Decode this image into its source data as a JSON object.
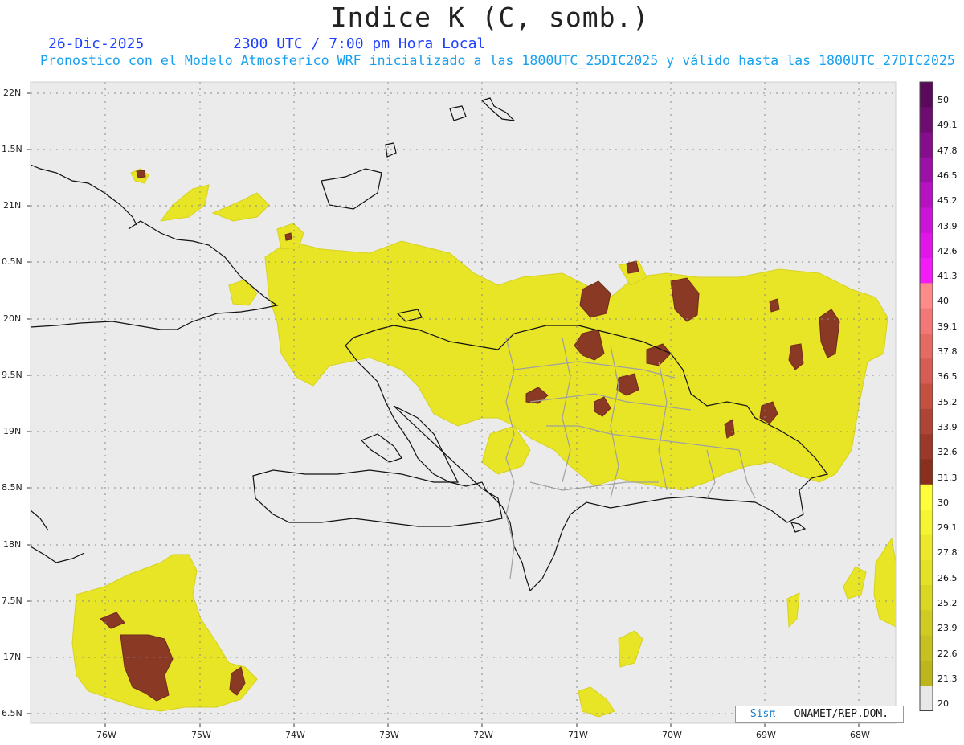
{
  "header": {
    "title": "Indice K (C, somb.)",
    "date": "26-Dic-2025",
    "time": "2300 UTC / 7:00 pm Hora Local",
    "description": "Pronostico con el Modelo Atmosferico WRF inicializado a las 1800UTC_25DIC2025 y válido hasta las  1800UTC_27DIC2025"
  },
  "axes": {
    "lat_labels": [
      "22N",
      "1.5N",
      "21N",
      "0.5N",
      "20N",
      "9.5N",
      "19N",
      "8.5N",
      "18N",
      "7.5N",
      "17N",
      "6.5N"
    ],
    "lon_labels": [
      "76W",
      "75W",
      "74W",
      "73W",
      "72W",
      "71W",
      "70W",
      "69W",
      "68W"
    ]
  },
  "colorbar": {
    "levels": [
      "50",
      "49.1",
      "47.8",
      "46.5",
      "45.2",
      "43.9",
      "42.6",
      "41.3",
      "40",
      "39.1",
      "37.8",
      "36.5",
      "35.2",
      "33.9",
      "32.6",
      "31.3",
      "30",
      "29.1",
      "27.8",
      "26.5",
      "25.2",
      "23.9",
      "22.6",
      "21.3",
      "20"
    ],
    "colors": [
      "#5a0a5a",
      "#6e0c72",
      "#860e8c",
      "#9c10a8",
      "#b612c2",
      "#cc14d6",
      "#e016e8",
      "#f21cf6",
      "#ff8a8a",
      "#f27878",
      "#e46a62",
      "#d65c54",
      "#c4503f",
      "#b04434",
      "#9c382a",
      "#8a2e1e",
      "#fdfd3a",
      "#f5f532",
      "#ece92c",
      "#e3e128",
      "#dad624",
      "#cfcb22",
      "#c6c020",
      "#bcb61c",
      "#e8e8e8"
    ]
  },
  "credit": {
    "logo": "Sisπ",
    "text": " – ONAMET/REP.DOM."
  }
}
